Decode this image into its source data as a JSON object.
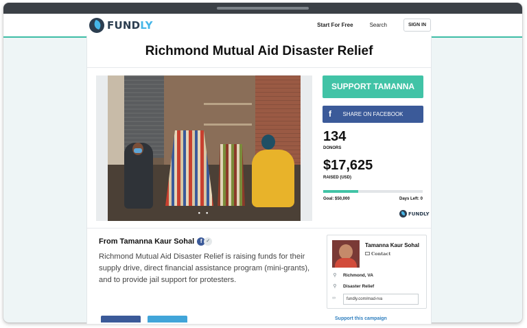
{
  "brand": {
    "logo_text": "FUND",
    "logo_text_accent": "LY"
  },
  "nav": {
    "start_for_free": "Start For Free",
    "search": "Search",
    "sign_in": "SIGN IN"
  },
  "campaign": {
    "title": "Richmond Mutual Aid Disaster Relief",
    "support_button": "SUPPORT TAMANNA",
    "facebook_button": "SHARE ON FACEBOOK",
    "donors_count": "134",
    "donors_label": "DONORS",
    "raised_amount": "$17,625",
    "raised_label": "RAISED (USD)",
    "progress_fraction": 0.35,
    "goal": "Goal: $50,000",
    "days_left": "Days Left: 0",
    "powered_by_text": "FUNDLY"
  },
  "story": {
    "from": "From Tamanna Kaur Sohal",
    "description": "Richmond Mutual Aid Disaster Relief is raising funds for their supply drive, direct financial assistance program (mini-grants), and to provide jail support for protesters."
  },
  "organizer": {
    "name": "Tamanna Kaur Sohal",
    "contact": "Contact",
    "location": "Richmond, VA",
    "category": "Disaster Relief",
    "url": "fundly.com/mad-rva",
    "support_link": "Support this campaign"
  },
  "colors": {
    "accent_green": "#41c3a6",
    "facebook_blue": "#3b5a99",
    "brand_navy": "#2c3e50",
    "brand_light_blue": "#45b6e8"
  }
}
